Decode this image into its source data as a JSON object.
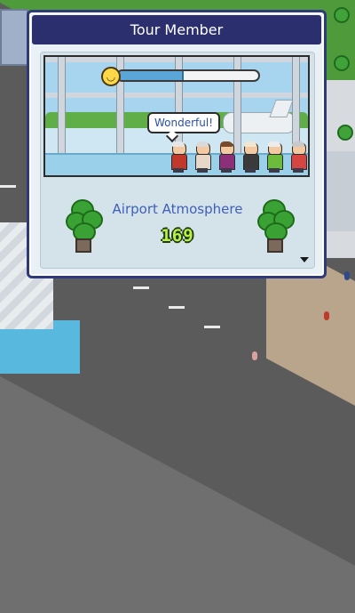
{
  "dialog": {
    "title": "Tour Member",
    "speech_bubble": "Wonderful!",
    "facility_name": "Airport Atmosphere",
    "score": "169",
    "satisfaction_fraction": 0.47,
    "icons": {
      "satisfaction": "happy-face-icon",
      "more": "triangle-down-icon",
      "decor": "potted-plant-icon"
    }
  },
  "tour_members": [
    {
      "hair": "#e6e6e6",
      "body": "#c0392b"
    },
    {
      "hair": "#d9d9d9",
      "body": "#e7d7c9"
    },
    {
      "hair": "#7a4b2b",
      "body": "#8e2f7a"
    },
    {
      "hair": "#f0e6d2",
      "body": "#3a3a3a"
    },
    {
      "hair": "#ececec",
      "body": "#6dbb3a"
    },
    {
      "hair": "#c9c9c9",
      "body": "#d64541"
    }
  ],
  "colors": {
    "title_bar": "#2b2f6e",
    "caption_text": "#3f5fb8",
    "score_text": "#b9f04c",
    "meter_fill": "#5aa6d8"
  }
}
